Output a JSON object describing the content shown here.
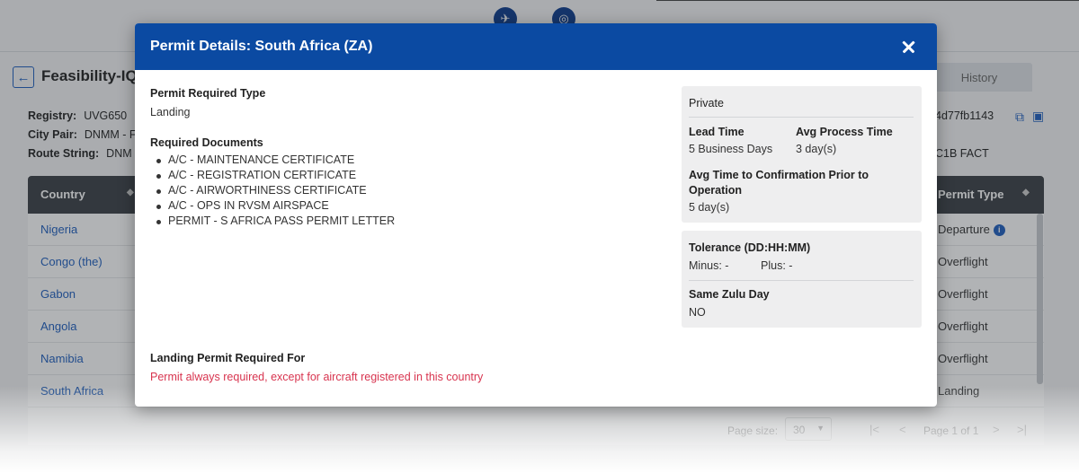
{
  "app": {
    "title": "Feasibility-IQ R",
    "tab_history": "History",
    "registry_label": "Registry:",
    "registry_value": "UVG650",
    "city_pair_label": "City Pair:",
    "city_pair_value": "DNMM - F",
    "route_string_label": "Route String:",
    "route_string_value": "DNM",
    "id_fragment": "4d77fb1143",
    "route_fragment": "C1B FACT"
  },
  "table": {
    "col_country": "Country",
    "col_permit_type": "Permit Type",
    "rows": [
      {
        "country": "Nigeria",
        "permit_type": "Departure"
      },
      {
        "country": "Congo (the)",
        "permit_type": "Overflight"
      },
      {
        "country": "Gabon",
        "permit_type": "Overflight"
      },
      {
        "country": "Angola",
        "permit_type": "Overflight"
      },
      {
        "country": "Namibia",
        "permit_type": "Overflight"
      },
      {
        "country": "South Africa",
        "permit_type": "Landing"
      }
    ]
  },
  "pager": {
    "page_size_label": "Page size:",
    "page_size_value": "30",
    "page_text": "Page 1 of 1"
  },
  "modal": {
    "title": "Permit Details: South Africa (ZA)",
    "permit_required_type_label": "Permit Required Type",
    "permit_required_type_value": "Landing",
    "required_documents_label": "Required Documents",
    "documents": [
      "A/C - MAINTENANCE CERTIFICATE",
      "A/C - REGISTRATION CERTIFICATE",
      "A/C - AIRWORTHINESS CERTIFICATE",
      "A/C - OPS IN RVSM AIRSPACE",
      "PERMIT - S AFRICA PASS PERMIT LETTER"
    ],
    "landing_required_label": "Landing Permit Required For",
    "landing_required_value": "Permit always required, except for aircraft registered in this country",
    "panel1": {
      "heading": "Private",
      "lead_time_label": "Lead Time",
      "lead_time_value": "5 Business Days",
      "avg_process_label": "Avg Process Time",
      "avg_process_value": "3 day(s)",
      "avg_confirm_label_line1": "Avg Time to Confirmation Prior to",
      "avg_confirm_label_line2": "Operation",
      "avg_confirm_value": "5 day(s)"
    },
    "panel2": {
      "tolerance_label": "Tolerance (DD:HH:MM)",
      "minus_text": "Minus: -",
      "plus_text": "Plus: -",
      "same_zulu_label": "Same Zulu Day",
      "same_zulu_value": "NO"
    }
  },
  "colors": {
    "header_blue": "#0b4aa2",
    "link_blue": "#1f5fbf",
    "warning_red": "#d8344f"
  },
  "icons": [
    "airplane-globe-icon",
    "globe-icon",
    "back-arrow-icon",
    "copy-icon",
    "comment-icon",
    "info-icon",
    "sort-icon",
    "close-icon"
  ]
}
